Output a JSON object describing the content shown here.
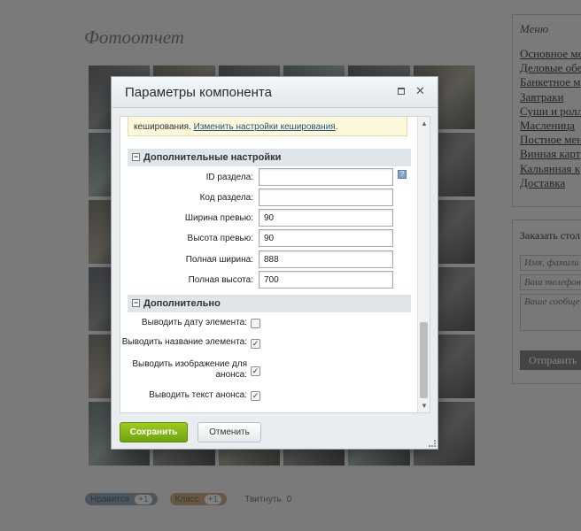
{
  "background": {
    "page_title": "Фотоотчет",
    "menu": {
      "title": "Меню",
      "items": [
        "Основное ме",
        "Деловые обе",
        "Банкетное м",
        "Завтраки",
        "Суши и ролл",
        "Масленица",
        "Постное мен",
        "Винная карт",
        "Кальянная к",
        "Доставка"
      ]
    },
    "order": {
      "title": "Заказать стол",
      "name_placeholder": "Имя, фамили",
      "phone_placeholder": "Ваш телефон",
      "message_placeholder": "Ваше сообще",
      "submit_label": "Отправить"
    },
    "social": {
      "vk_label": "Нравится",
      "vk_count": "+1",
      "ok_label": "Класс",
      "ok_count": "+1",
      "tw_label": "Твитнуть",
      "tw_count": "0"
    }
  },
  "dialog": {
    "title": "Параметры компонента",
    "cache_note_text": "кеширования.",
    "cache_note_link": "Изменить настройки кеширования",
    "section_additional_settings": "Дополнительные настройки",
    "fields": [
      {
        "label": "ID раздела:",
        "value": ""
      },
      {
        "label": "Код раздела:",
        "value": ""
      },
      {
        "label": "Ширина превью:",
        "value": "90"
      },
      {
        "label": "Высота превью:",
        "value": "90"
      },
      {
        "label": "Полная ширина:",
        "value": "888"
      },
      {
        "label": "Полная высота:",
        "value": "700"
      }
    ],
    "help_icon_glyph": "?",
    "section_additional": "Дополнительно",
    "options": [
      {
        "label": "Выводить дату элемента:",
        "checked": false
      },
      {
        "label": "Выводить название элемента:",
        "checked": true
      },
      {
        "label_line1": "Выводить изображение для",
        "label_line2": "анонса:",
        "checked": true
      },
      {
        "label": "Выводить текст анонса:",
        "checked": true
      }
    ],
    "save_label": "Сохранить",
    "cancel_label": "Отменить",
    "accent_color": "#7fb317"
  }
}
